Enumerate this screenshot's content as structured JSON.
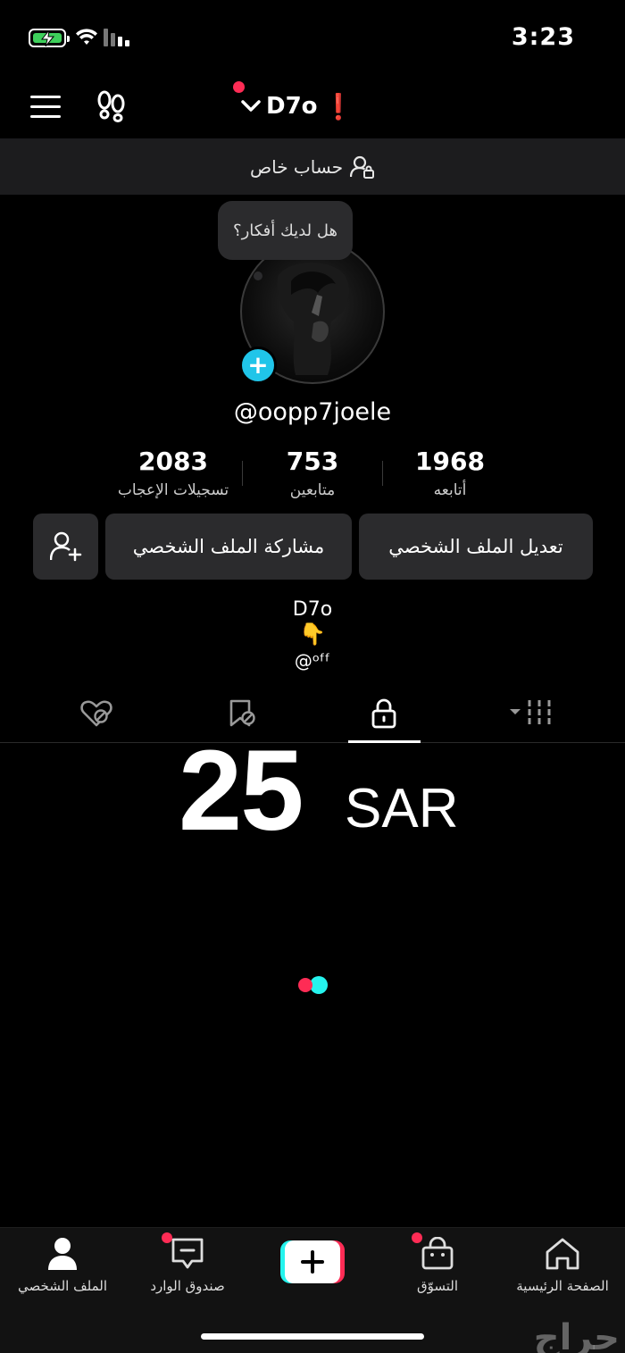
{
  "status_bar": {
    "time": "3:23"
  },
  "header": {
    "username": "D7o",
    "alert": "❗"
  },
  "private_bar": {
    "label": "حساب خاص"
  },
  "profile": {
    "bubble_text": "هل لديك أفكار؟",
    "handle": "@oopp7joele",
    "stats": [
      {
        "value": "2083",
        "label": "تسجيلات الإعجاب"
      },
      {
        "value": "753",
        "label": "متابعين"
      },
      {
        "value": "1968",
        "label": "أتابعه"
      }
    ],
    "buttons": {
      "edit": "تعديل الملف الشخصي",
      "share": "مشاركة الملف الشخصي"
    },
    "bio": {
      "name": "D7o",
      "emoji": "👇",
      "line": "@ᵒᶠᶠ"
    }
  },
  "tabs": [
    {
      "icon": "liked-hidden-icon"
    },
    {
      "icon": "saved-hidden-icon"
    },
    {
      "icon": "lock-icon",
      "active": true
    },
    {
      "icon": "grid-icon"
    }
  ],
  "overlay": {
    "price": "25",
    "currency": "SAR"
  },
  "bottom_nav": {
    "profile": "الملف الشخصي",
    "inbox": "صندوق الوارد",
    "shop": "التسوّق",
    "home": "الصفحة الرئيسية"
  },
  "watermark": "حراج",
  "colors": {
    "accent_red": "#fe2c55",
    "accent_cyan": "#25f4ee",
    "avatar_add": "#20c5e9"
  }
}
